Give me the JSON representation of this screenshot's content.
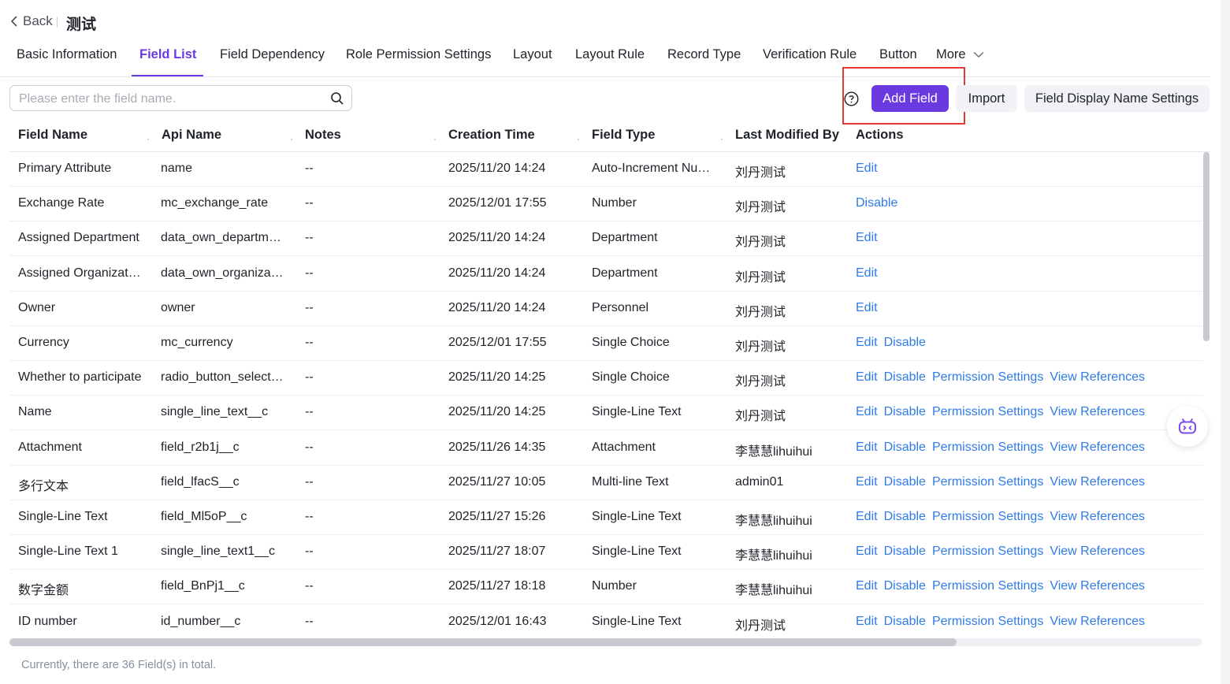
{
  "header": {
    "back_label": "Back",
    "object_title": "测试"
  },
  "tabs": [
    {
      "label": "Basic Information"
    },
    {
      "label": "Field List"
    },
    {
      "label": "Field Dependency"
    },
    {
      "label": "Role Permission Settings"
    },
    {
      "label": "Layout"
    },
    {
      "label": "Layout Rule"
    },
    {
      "label": "Record Type"
    },
    {
      "label": "Verification Rule"
    },
    {
      "label": "Button"
    },
    {
      "label": "More"
    }
  ],
  "active_tab": "Field List",
  "search": {
    "placeholder": "Please enter the field name.",
    "value": ""
  },
  "toolbar": {
    "add_label": "Add Field",
    "import_label": "Import",
    "display_label": "Field Display Name Settings"
  },
  "table": {
    "columns": [
      "Field Name",
      "Api Name",
      "Notes",
      "Creation Time",
      "Field Type",
      "Last Modified By",
      "Actions"
    ],
    "rows": [
      {
        "name": "Primary Attribute",
        "api": "name",
        "notes": "--",
        "time": "2025/11/20 14:24",
        "type": "Auto-Increment Nu…",
        "modified": "刘丹测试",
        "actions": [
          "Edit"
        ]
      },
      {
        "name": "Exchange Rate",
        "api": "mc_exchange_rate",
        "notes": "--",
        "time": "2025/12/01 17:55",
        "type": "Number",
        "modified": "刘丹测试",
        "actions": [
          "Disable"
        ]
      },
      {
        "name": "Assigned Department",
        "api": "data_own_departm…",
        "notes": "--",
        "time": "2025/11/20 14:24",
        "type": "Department",
        "modified": "刘丹测试",
        "actions": [
          "Edit"
        ]
      },
      {
        "name": "Assigned Organizat…",
        "api": "data_own_organiza…",
        "notes": "--",
        "time": "2025/11/20 14:24",
        "type": "Department",
        "modified": "刘丹测试",
        "actions": [
          "Edit"
        ]
      },
      {
        "name": "Owner",
        "api": "owner",
        "notes": "--",
        "time": "2025/11/20 14:24",
        "type": "Personnel",
        "modified": "刘丹测试",
        "actions": [
          "Edit"
        ]
      },
      {
        "name": "Currency",
        "api": "mc_currency",
        "notes": "--",
        "time": "2025/12/01 17:55",
        "type": "Single Choice",
        "modified": "刘丹测试",
        "actions": [
          "Edit",
          "Disable"
        ]
      },
      {
        "name": "Whether to participate",
        "api": "radio_button_select…",
        "notes": "--",
        "time": "2025/11/20 14:25",
        "type": "Single Choice",
        "modified": "刘丹测试",
        "actions": [
          "Edit",
          "Disable",
          "Permission Settings",
          "View References"
        ]
      },
      {
        "name": "Name",
        "api": "single_line_text__c",
        "notes": "--",
        "time": "2025/11/20 14:25",
        "type": "Single-Line Text",
        "modified": "刘丹测试",
        "actions": [
          "Edit",
          "Disable",
          "Permission Settings",
          "View References"
        ]
      },
      {
        "name": "Attachment",
        "api": "field_r2b1j__c",
        "notes": "--",
        "time": "2025/11/26 14:35",
        "type": "Attachment",
        "modified": "李慧慧lihuihui",
        "actions": [
          "Edit",
          "Disable",
          "Permission Settings",
          "View References"
        ]
      },
      {
        "name": "多行文本",
        "api": "field_lfacS__c",
        "notes": "--",
        "time": "2025/11/27 10:05",
        "type": "Multi-line Text",
        "modified": "admin01",
        "actions": [
          "Edit",
          "Disable",
          "Permission Settings",
          "View References"
        ]
      },
      {
        "name": "Single-Line Text",
        "api": "field_Ml5oP__c",
        "notes": "--",
        "time": "2025/11/27 15:26",
        "type": "Single-Line Text",
        "modified": "李慧慧lihuihui",
        "actions": [
          "Edit",
          "Disable",
          "Permission Settings",
          "View References"
        ]
      },
      {
        "name": "Single-Line Text 1",
        "api": "single_line_text1__c",
        "notes": "--",
        "time": "2025/11/27 18:07",
        "type": "Single-Line Text",
        "modified": "李慧慧lihuihui",
        "actions": [
          "Edit",
          "Disable",
          "Permission Settings",
          "View References"
        ]
      },
      {
        "name": "数字金额",
        "api": "field_BnPj1__c",
        "notes": "--",
        "time": "2025/11/27 18:18",
        "type": "Number",
        "modified": "李慧慧lihuihui",
        "actions": [
          "Edit",
          "Disable",
          "Permission Settings",
          "View References"
        ]
      },
      {
        "name": "ID number",
        "api": "id_number__c",
        "notes": "--",
        "time": "2025/12/01 16:43",
        "type": "Single-Line Text",
        "modified": "刘丹测试",
        "actions": [
          "Edit",
          "Disable",
          "Permission Settings",
          "View References"
        ]
      }
    ]
  },
  "footer": {
    "total_text": "Currently, there are 36 Field(s) in total."
  },
  "icons": {
    "back": "chevron-left-icon",
    "more": "chevron-down-icon",
    "search": "search-icon",
    "help": "question-circle-icon",
    "assistant": "robot-assistant-icon"
  },
  "colors": {
    "accent": "#6a39e0",
    "link": "#2f7be8",
    "highlight": "#e53935"
  }
}
